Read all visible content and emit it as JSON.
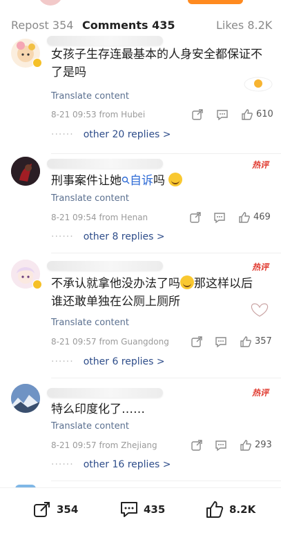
{
  "tabs": {
    "repost": "Repost 354",
    "comments": "Comments 435",
    "likes": "Likes 8.2K"
  },
  "comments": [
    {
      "text": "女孩子生存连最基本的人身安全都保证不了是吗",
      "translate": "Translate content",
      "meta": "8-21 09:53  from Hubei",
      "likes": "610",
      "replies": "other 20 replies >"
    },
    {
      "text_before": "刑事案件让她",
      "text_link": "自诉",
      "text_after": "吗",
      "hot": "热评",
      "translate": "Translate content",
      "meta": "8-21 09:54  from Henan",
      "likes": "469",
      "replies": "other 8 replies >"
    },
    {
      "text_before": "不承认就拿他没办法了吗",
      "text_after": "那这样以后谁还敢单独在公厕上厕所",
      "hot": "热评",
      "translate": "Translate content",
      "meta": "8-21 09:57  from Guangdong",
      "likes": "357",
      "replies": "other 6 replies >"
    },
    {
      "text": "特么印度化了……",
      "hot": "热评",
      "translate": "Translate content",
      "meta": "8-21 09:57  from Zhejiang",
      "likes": "293",
      "replies": "other 16 replies >"
    }
  ],
  "bottom": {
    "repost": "354",
    "comment": "435",
    "like": "8.2K"
  },
  "colors": {
    "accent": "#ff8a1f",
    "link": "#2e4d8a",
    "hot": "#e03a2f"
  }
}
